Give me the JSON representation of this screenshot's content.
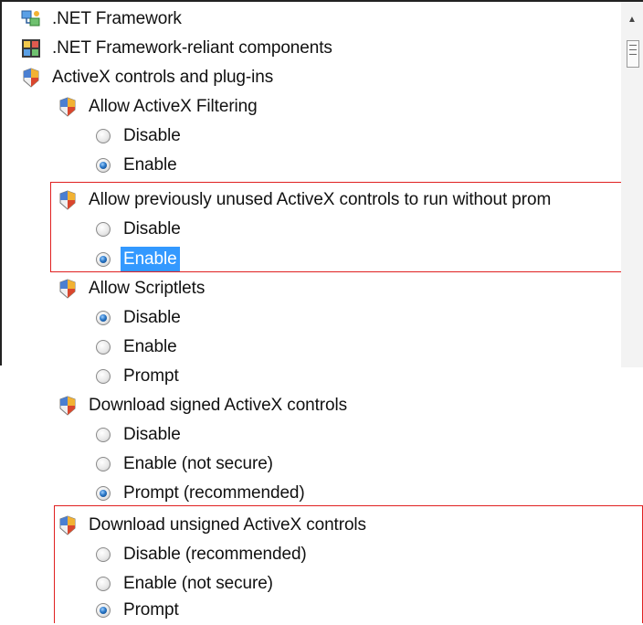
{
  "tree": {
    "items": [
      {
        "type": "folder",
        "icon": "network-framework-icon",
        "label": ".NET Framework"
      },
      {
        "type": "folder",
        "icon": "framework-components-icon",
        "label": ".NET Framework-reliant components"
      },
      {
        "type": "folder",
        "icon": "policy-shield-icon",
        "label": "ActiveX controls and plug-ins"
      },
      {
        "type": "setting",
        "icon": "policy-shield-icon",
        "label": "Allow ActiveX Filtering"
      },
      {
        "type": "option",
        "label": "Disable",
        "checked": false
      },
      {
        "type": "option",
        "label": "Enable",
        "checked": true
      },
      {
        "type": "setting",
        "icon": "policy-shield-icon",
        "label": "Allow previously unused ActiveX controls to run without prom"
      },
      {
        "type": "option",
        "label": "Disable",
        "checked": false
      },
      {
        "type": "option",
        "label": "Enable",
        "checked": true,
        "selected": true
      },
      {
        "type": "setting",
        "icon": "policy-shield-icon",
        "label": "Allow Scriptlets"
      },
      {
        "type": "option",
        "label": "Disable",
        "checked": true
      },
      {
        "type": "option",
        "label": "Enable",
        "checked": false
      },
      {
        "type": "option",
        "label": "Prompt",
        "checked": false
      },
      {
        "type": "setting",
        "icon": "policy-shield-icon",
        "label": "Download signed ActiveX controls"
      },
      {
        "type": "option",
        "label": "Disable",
        "checked": false
      },
      {
        "type": "option",
        "label": "Enable (not secure)",
        "checked": false
      },
      {
        "type": "option",
        "label": "Prompt (recommended)",
        "checked": true
      },
      {
        "type": "setting",
        "icon": "policy-shield-icon",
        "label": "Download unsigned ActiveX controls"
      },
      {
        "type": "option",
        "label": "Disable (recommended)",
        "checked": false
      },
      {
        "type": "option",
        "label": "Enable (not secure)",
        "checked": false
      },
      {
        "type": "option",
        "label": "Prompt",
        "checked": true
      }
    ]
  },
  "colors": {
    "highlight_box": "#e02020",
    "selection": "#3399ff",
    "radio_checked": "#2b78c8"
  }
}
